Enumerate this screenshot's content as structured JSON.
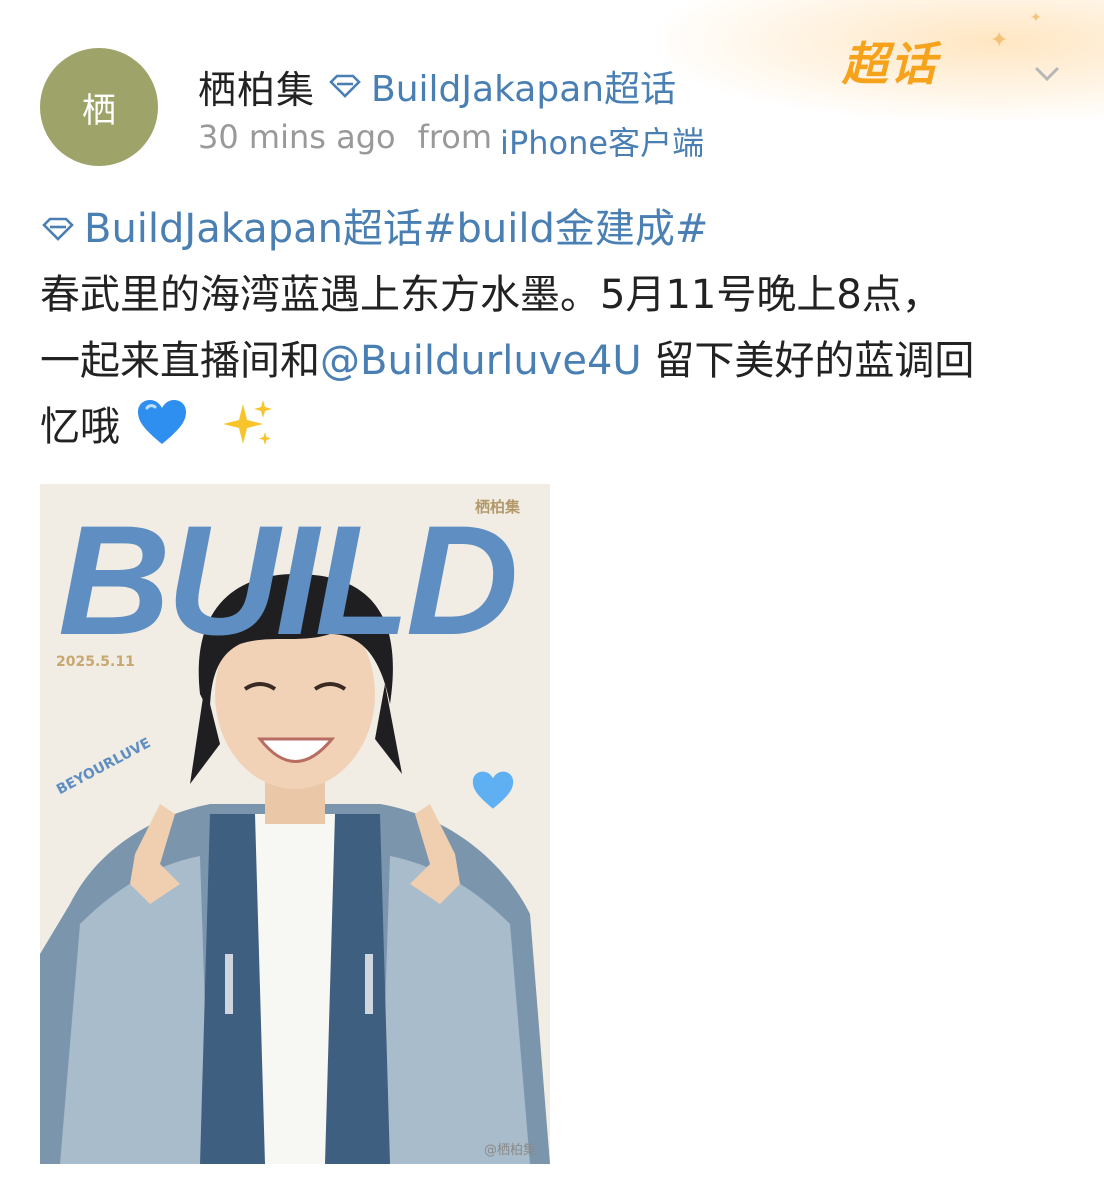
{
  "badge": {
    "label": "超话"
  },
  "author": {
    "avatar_text": "栖",
    "name": "栖柏集",
    "topic": "BuildJakapan超话"
  },
  "meta": {
    "time": "30 mins ago",
    "from_label": "from",
    "device": "iPhone客户端"
  },
  "post": {
    "hashtag_topic": "BuildJakapan超话",
    "hashtag_tag": "#build金建成#",
    "line1": "春武里的海湾蓝遇上东方水墨。5月11号晚上8点，",
    "line2_before": "一起来直播间和",
    "mention": "@Buildurluve4U",
    "line2_after": " 留下美好的蓝调回",
    "line3": "忆哦"
  },
  "poster": {
    "brand": "栖柏集",
    "title": "BUILD",
    "date": "2025.5.11",
    "vertical_text": "BEYOURLUVE",
    "watermark": "@栖柏集"
  },
  "colors": {
    "link": "#4a7fb3",
    "badge": "#f7a21b",
    "avatar_bg": "#9da369",
    "poster_title": "#5f8fc2"
  }
}
